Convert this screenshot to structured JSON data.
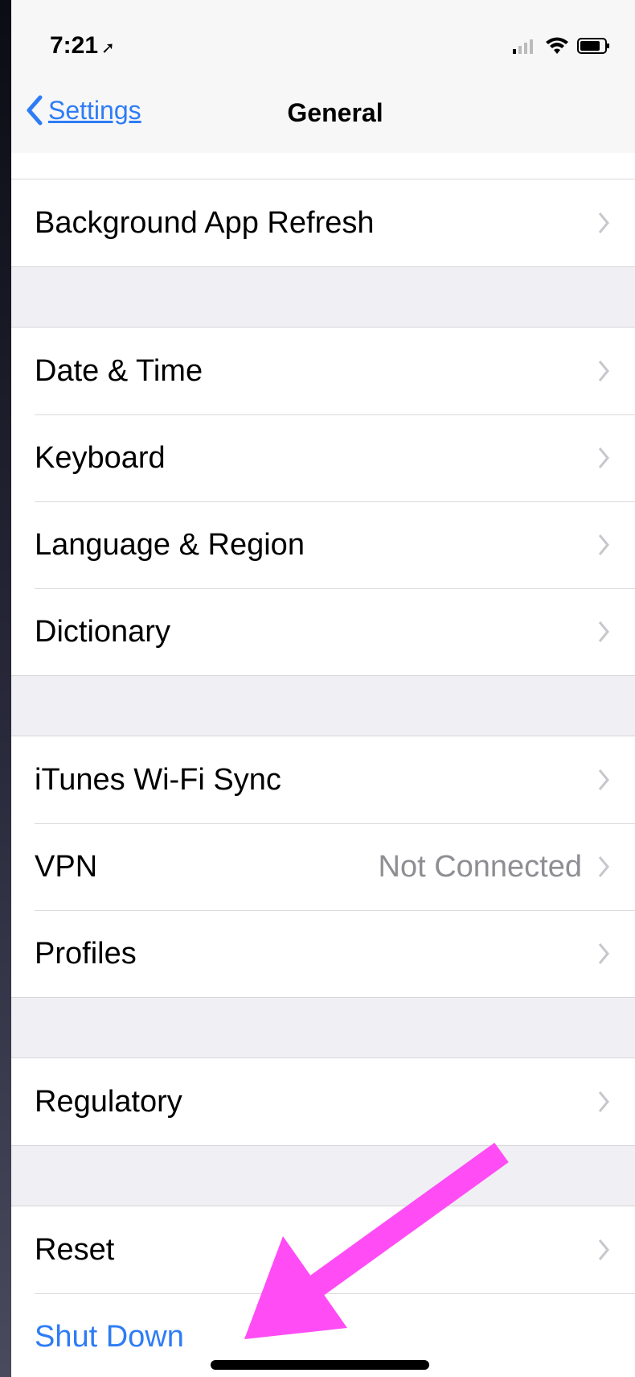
{
  "status_bar": {
    "time": "7:21",
    "location_icon": "location-arrow-icon",
    "signal_icon": "cellular-signal-icon",
    "wifi_icon": "wifi-icon",
    "battery_icon": "battery-icon"
  },
  "nav": {
    "back_label": "Settings",
    "title": "General"
  },
  "sections": [
    {
      "rows": [
        {
          "label": "Background App Refresh",
          "detail": ""
        }
      ]
    },
    {
      "rows": [
        {
          "label": "Date & Time",
          "detail": ""
        },
        {
          "label": "Keyboard",
          "detail": ""
        },
        {
          "label": "Language & Region",
          "detail": ""
        },
        {
          "label": "Dictionary",
          "detail": ""
        }
      ]
    },
    {
      "rows": [
        {
          "label": "iTunes Wi-Fi Sync",
          "detail": ""
        },
        {
          "label": "VPN",
          "detail": "Not Connected"
        },
        {
          "label": "Profiles",
          "detail": ""
        }
      ]
    },
    {
      "rows": [
        {
          "label": "Regulatory",
          "detail": ""
        }
      ]
    },
    {
      "rows": [
        {
          "label": "Reset",
          "detail": ""
        },
        {
          "label": "Shut Down",
          "detail": ""
        }
      ]
    }
  ],
  "colors": {
    "accent": "#2e7cf6",
    "annotation_arrow": "#ff4cf5"
  }
}
